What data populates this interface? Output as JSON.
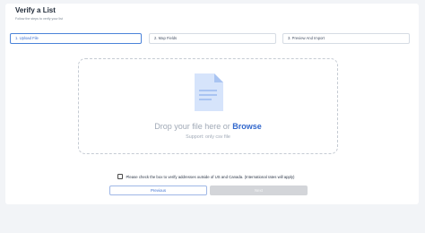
{
  "page": {
    "title": "Verify a List",
    "subtitle": "Follow the steps to verify your list"
  },
  "steps": [
    {
      "label": "1. Upload File",
      "active": true
    },
    {
      "label": "2. Map Fields",
      "active": false
    },
    {
      "label": "3. Preview And Import",
      "active": false
    }
  ],
  "dropzone": {
    "prompt": "Drop your file here or",
    "browse_label": "Browse",
    "support_text": "Support: only csv file",
    "icon": "file-icon"
  },
  "international": {
    "checked": false,
    "label": "Please check the box to verify addresses outside of US and Canada. (International rates will apply)"
  },
  "buttons": {
    "previous": "Previous",
    "next": "Next"
  },
  "colors": {
    "accent": "#3167cc",
    "background": "#f2f4f7",
    "disabled": "#d3d5d9"
  }
}
